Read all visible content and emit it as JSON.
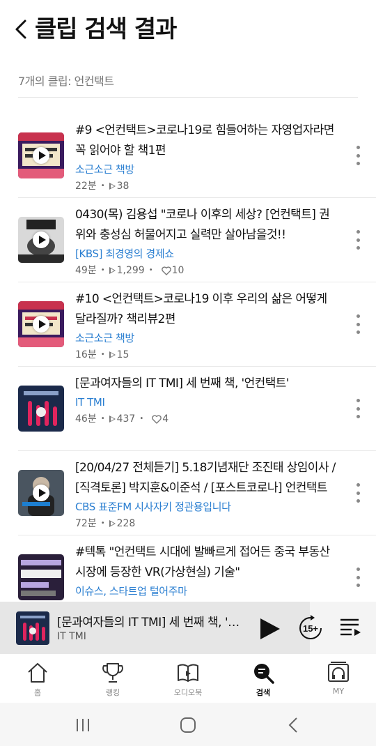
{
  "header": {
    "title": "클립 검색 결과"
  },
  "summary": "7개의 클립: 언컨택트",
  "clips": [
    {
      "title": "#9 <언컨택트>코로나19로 힘들어하는 자영업자라면 꼭 읽어야 할 책1편",
      "channel": "소근소근 책방",
      "duration": "22분",
      "plays": "38",
      "likes": ""
    },
    {
      "title": "0430(목) 김용섭 \"코로나 이후의 세상? [언컨택트] 권위와 충성심 허물어지고 실력만 살아남을것!!",
      "channel": "[KBS] 최경영의 경제쇼",
      "duration": "49분",
      "plays": "1,299",
      "likes": "10"
    },
    {
      "title": "#10 <언컨택트>코로나19 이후 우리의 삶은 어떻게 달라질까? 책리뷰2편",
      "channel": "소근소근 책방",
      "duration": "16분",
      "plays": "15",
      "likes": ""
    },
    {
      "title": "[문과여자들의 IT TMI] 세 번째 책, '언컨택트'",
      "channel": "IT TMI",
      "duration": "46분",
      "plays": "437",
      "likes": "4"
    },
    {
      "title": "[20/04/27 전체듣기] 5.18기념재단 조진태 상임이사 / [직격토론] 박지훈&이준석 / [포스트코로나] 언컨택트",
      "channel": "CBS 표준FM 시사자키 정관용입니다",
      "duration": "72분",
      "plays": "228",
      "likes": ""
    },
    {
      "title": "#텍톡 \"언컨택트 시대에 발빠르게 접어든 중국 부동산 시장에 등장한 VR(가상현실) 기술\"",
      "channel": "이슈스, 스타트업 털어주마",
      "duration": "",
      "plays": "",
      "likes": ""
    }
  ],
  "player": {
    "title": "[문과여자들의 IT TMI] 세 번째 책, '언컨택트'",
    "channel": "IT TMI",
    "skip_label": "15+"
  },
  "tabs": [
    {
      "label": "홈",
      "icon": "home-icon"
    },
    {
      "label": "랭킹",
      "icon": "trophy-icon"
    },
    {
      "label": "오디오북",
      "icon": "book-icon"
    },
    {
      "label": "검색",
      "icon": "search-icon"
    },
    {
      "label": "MY",
      "icon": "headphones-icon"
    }
  ],
  "colors": {
    "accent_blue": "#2b7fd1",
    "active": "#111111",
    "inactive": "#888888"
  }
}
